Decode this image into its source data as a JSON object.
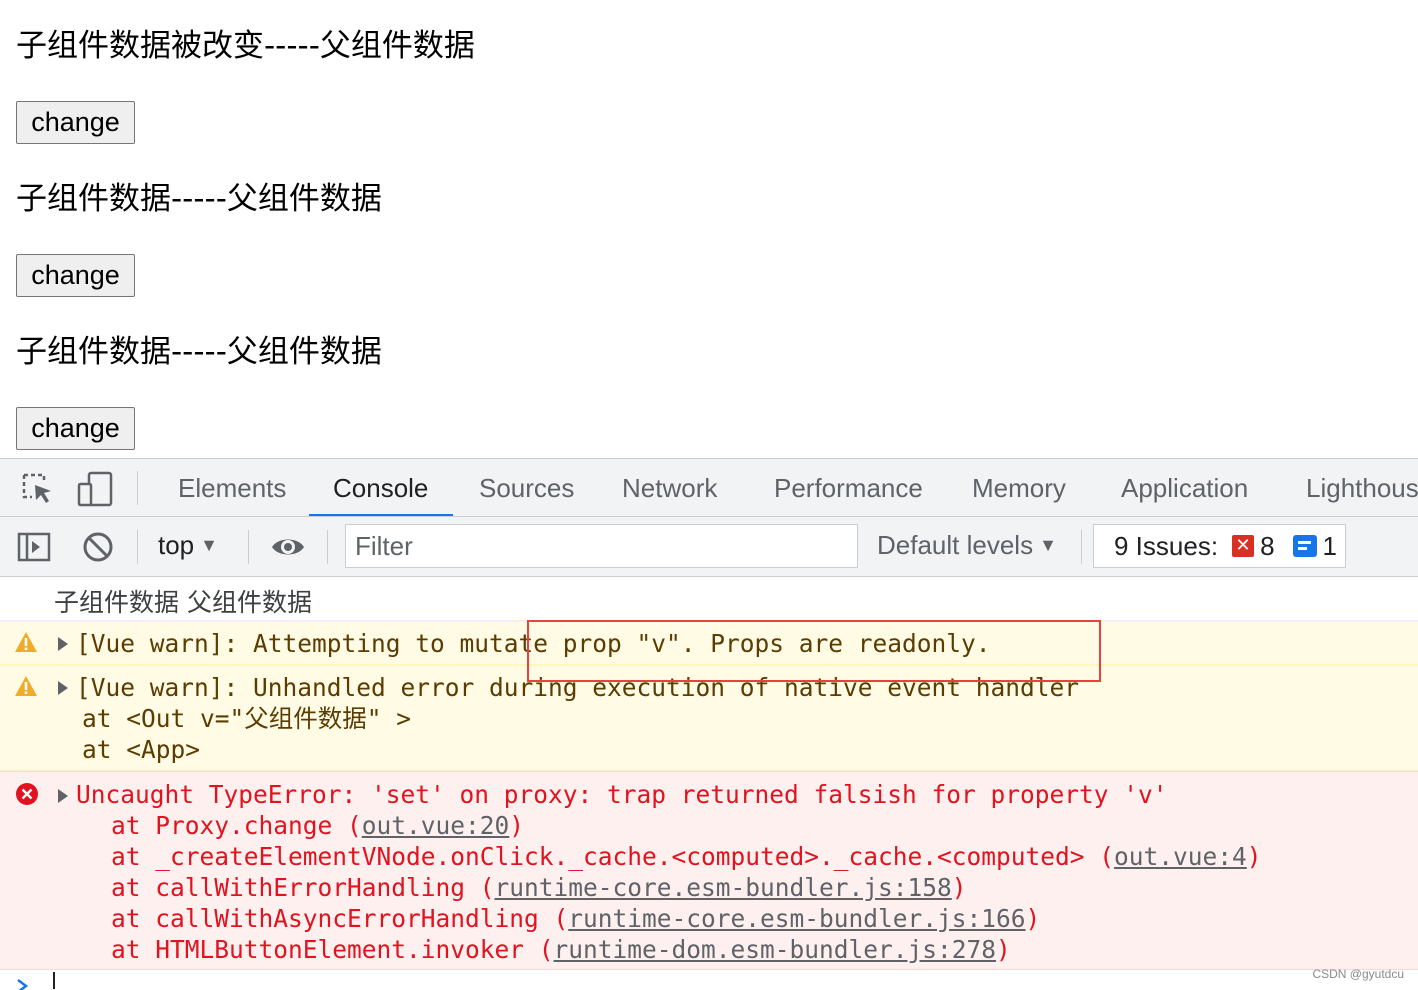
{
  "page": {
    "lines": [
      {
        "text": "子组件数据被改变-----父组件数据",
        "button": "change"
      },
      {
        "text": "子组件数据-----父组件数据",
        "button": "change"
      },
      {
        "text": "子组件数据-----父组件数据",
        "button": "change"
      }
    ]
  },
  "devtools": {
    "tabs": [
      "Elements",
      "Console",
      "Sources",
      "Network",
      "Performance",
      "Memory",
      "Application",
      "Lighthous"
    ],
    "active_tab": "Console",
    "toolbar": {
      "context": "top",
      "filter_placeholder": "Filter",
      "levels": "Default levels",
      "issues_label": "9 Issues:",
      "issues_errors": "8",
      "issues_info": "1"
    },
    "accent_color": "#1a73e8",
    "console": {
      "log": "子组件数据 父组件数据",
      "warn1": "[Vue warn]: Attempting to mutate prop \"v\". Props are readonly.",
      "warn2": {
        "line1": "[Vue warn]: Unhandled error during execution of native event handler",
        "line2": "at <Out v=\"父组件数据\" >",
        "line3": "at <App>"
      },
      "error": {
        "message": "Uncaught TypeError: 'set' on proxy: trap returned falsish for property 'v'",
        "stack": [
          {
            "prefix": "at Proxy.change (",
            "link": "out.vue:20",
            "suffix": ")"
          },
          {
            "prefix": "at _createElementVNode.onClick._cache.<computed>._cache.<computed> (",
            "link": "out.vue:4",
            "suffix": ")"
          },
          {
            "prefix": "at callWithErrorHandling (",
            "link": "runtime-core.esm-bundler.js:158",
            "suffix": ")"
          },
          {
            "prefix": "at callWithAsyncErrorHandling (",
            "link": "runtime-core.esm-bundler.js:166",
            "suffix": ")"
          },
          {
            "prefix": "at HTMLButtonElement.invoker (",
            "link": "runtime-dom.esm-bundler.js:278",
            "suffix": ")"
          }
        ]
      }
    }
  },
  "watermark": "CSDN @gyutdcu"
}
